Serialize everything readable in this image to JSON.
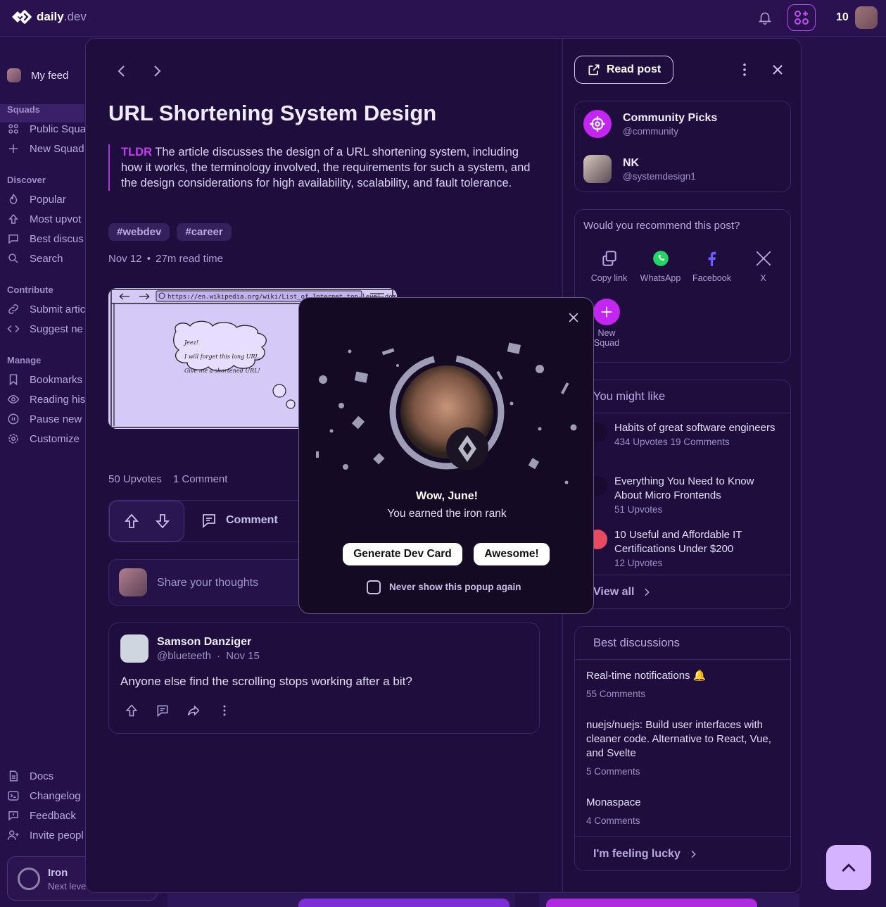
{
  "topbar": {
    "logo_main": "daily",
    "logo_suffix": ".dev",
    "streak": "10"
  },
  "sidebar": {
    "my_feed": "My feed",
    "squads_heading": "Squads",
    "squads": [
      "Public Squa",
      "New Squad"
    ],
    "discover_heading": "Discover",
    "discover": [
      "Popular",
      "Most upvot",
      "Best discus",
      "Search"
    ],
    "contribute_heading": "Contribute",
    "contribute": [
      "Submit artic",
      "Suggest ne"
    ],
    "manage_heading": "Manage",
    "manage": [
      "Bookmarks",
      "Reading his",
      "Pause new",
      "Customize"
    ],
    "footer": [
      "Docs",
      "Changelog",
      "Feedback",
      "Invite peopl"
    ],
    "rank": {
      "title": "Iron",
      "subtitle": "Next leve"
    }
  },
  "post": {
    "title": "URL Shortening System Design",
    "tldr_label": "TLDR",
    "tldr_text": " The article discusses the design of a URL shortening system, including how it works, the terminology involved, the requirements for such a system, and the design considerations for high availability, scalability, and fault tolerance.",
    "tags": [
      "#webdev",
      "#career"
    ],
    "date": "Nov 12",
    "read_time": "27m read time",
    "thumb_url_text": "https://en.wikipedia.org/wiki/List_of_Internet_top-level_domains#ICAN",
    "thumb_bubble": [
      "Jeez!",
      "I will forget this long URL.",
      "Give me a shortened URL!"
    ],
    "upvotes": "50 Upvotes",
    "comments": "1 Comment",
    "comment_label": "Comment",
    "share_placeholder": "Share your thoughts"
  },
  "comment": {
    "author": "Samson Danziger",
    "handle": "@blueteeth",
    "date": "Nov 15",
    "body": "Anyone else find the scrolling stops working after a bit?"
  },
  "right": {
    "read_post": "Read post",
    "sources": [
      {
        "name": "Community Picks",
        "handle": "@community"
      },
      {
        "name": "NK",
        "handle": "@systemdesign1"
      }
    ],
    "recommend_title": "Would you recommend this post?",
    "share_options": [
      "Copy link",
      "WhatsApp",
      "Facebook",
      "X"
    ],
    "new_squad": [
      "New",
      "Squad"
    ],
    "you_might_like": "You might like",
    "suggestions": [
      {
        "title": "Habits of great software engineers",
        "stats": "434 Upvotes  19 Comments"
      },
      {
        "title": "Everything You Need to Know About Micro Frontends",
        "stats": "51 Upvotes"
      },
      {
        "title": "10 Useful and Affordable IT Certifications Under $200",
        "stats": "12 Upvotes"
      }
    ],
    "view_all": "View all",
    "best_discussions": "Best discussions",
    "discussions": [
      {
        "title": "Real-time notifications 🔔",
        "stats": "55 Comments"
      },
      {
        "title": "nuejs/nuejs: Build user interfaces with cleaner code. Alternative to React, Vue, and Svelte",
        "stats": "5 Comments"
      },
      {
        "title": "Monaspace",
        "stats": "4 Comments"
      }
    ],
    "feeling_lucky": "I'm feeling lucky"
  },
  "popup": {
    "title": "Wow, June!",
    "subtitle": "You earned the iron rank",
    "generate_button": "Generate Dev Card",
    "awesome_button": "Awesome!",
    "never_show": "Never show this popup again"
  },
  "colors": {
    "background": "#25104a",
    "accent": "#c326f0",
    "modal": "#1e0d3d"
  }
}
